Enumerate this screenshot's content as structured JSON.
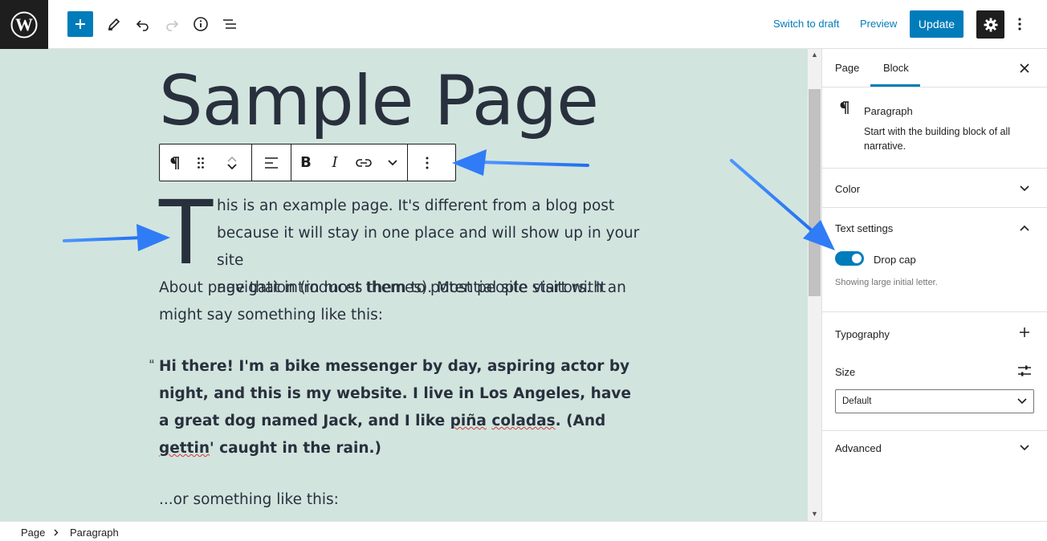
{
  "topbar": {
    "switch_to_draft": "Switch to draft",
    "preview": "Preview",
    "update": "Update"
  },
  "icons": [
    "wordpress-logo",
    "plus",
    "pencil",
    "undo",
    "redo",
    "info",
    "list-view",
    "gear",
    "more-vertical",
    "paragraph",
    "drag-handle",
    "chevron-up",
    "chevron-down",
    "align-left",
    "bold",
    "italic",
    "link",
    "close",
    "plus",
    "sliders"
  ],
  "editor": {
    "title": "Sample Page",
    "drop_cap": "T",
    "para1_lines": [
      "his is an example page. It's different from a blog post",
      "because it will stay in one place and will show up in your site",
      "navigation (in most themes). Most people start with an"
    ],
    "para1_rest": "About page that introduces them to potential site visitors. It might say something like this:",
    "quote_mark": "“",
    "quote_line1": "Hi there! I'm a bike messenger by day, aspiring actor by night, and this is my website. I live in Los Angeles, have a great dog named Jack, and I like ",
    "quote_pina": "piña",
    "quote_space": " ",
    "quote_coladas": "coladas",
    "quote_mid": ". (And ",
    "quote_gettin": "gettin",
    "quote_end": "' caught in the rain.)",
    "para2": "...or something like this:"
  },
  "toolbar_labels": {
    "bold": "B",
    "italic": "I"
  },
  "sidebar": {
    "tabs": [
      "Page",
      "Block"
    ],
    "active_tab": "Block",
    "block_name": "Paragraph",
    "block_desc": "Start with the building block of all narrative.",
    "panels": {
      "color": "Color",
      "text_settings": "Text settings",
      "drop_cap_label": "Drop cap",
      "drop_cap_on": true,
      "drop_cap_help": "Showing large initial letter.",
      "typography": "Typography",
      "size_label": "Size",
      "size_value": "Default",
      "advanced": "Advanced"
    }
  },
  "breadcrumb": [
    "Page",
    "Paragraph"
  ],
  "colors": {
    "accent": "#007cba",
    "canvas_bg": "#d2e4de",
    "arrow": "#2f7cf6"
  }
}
